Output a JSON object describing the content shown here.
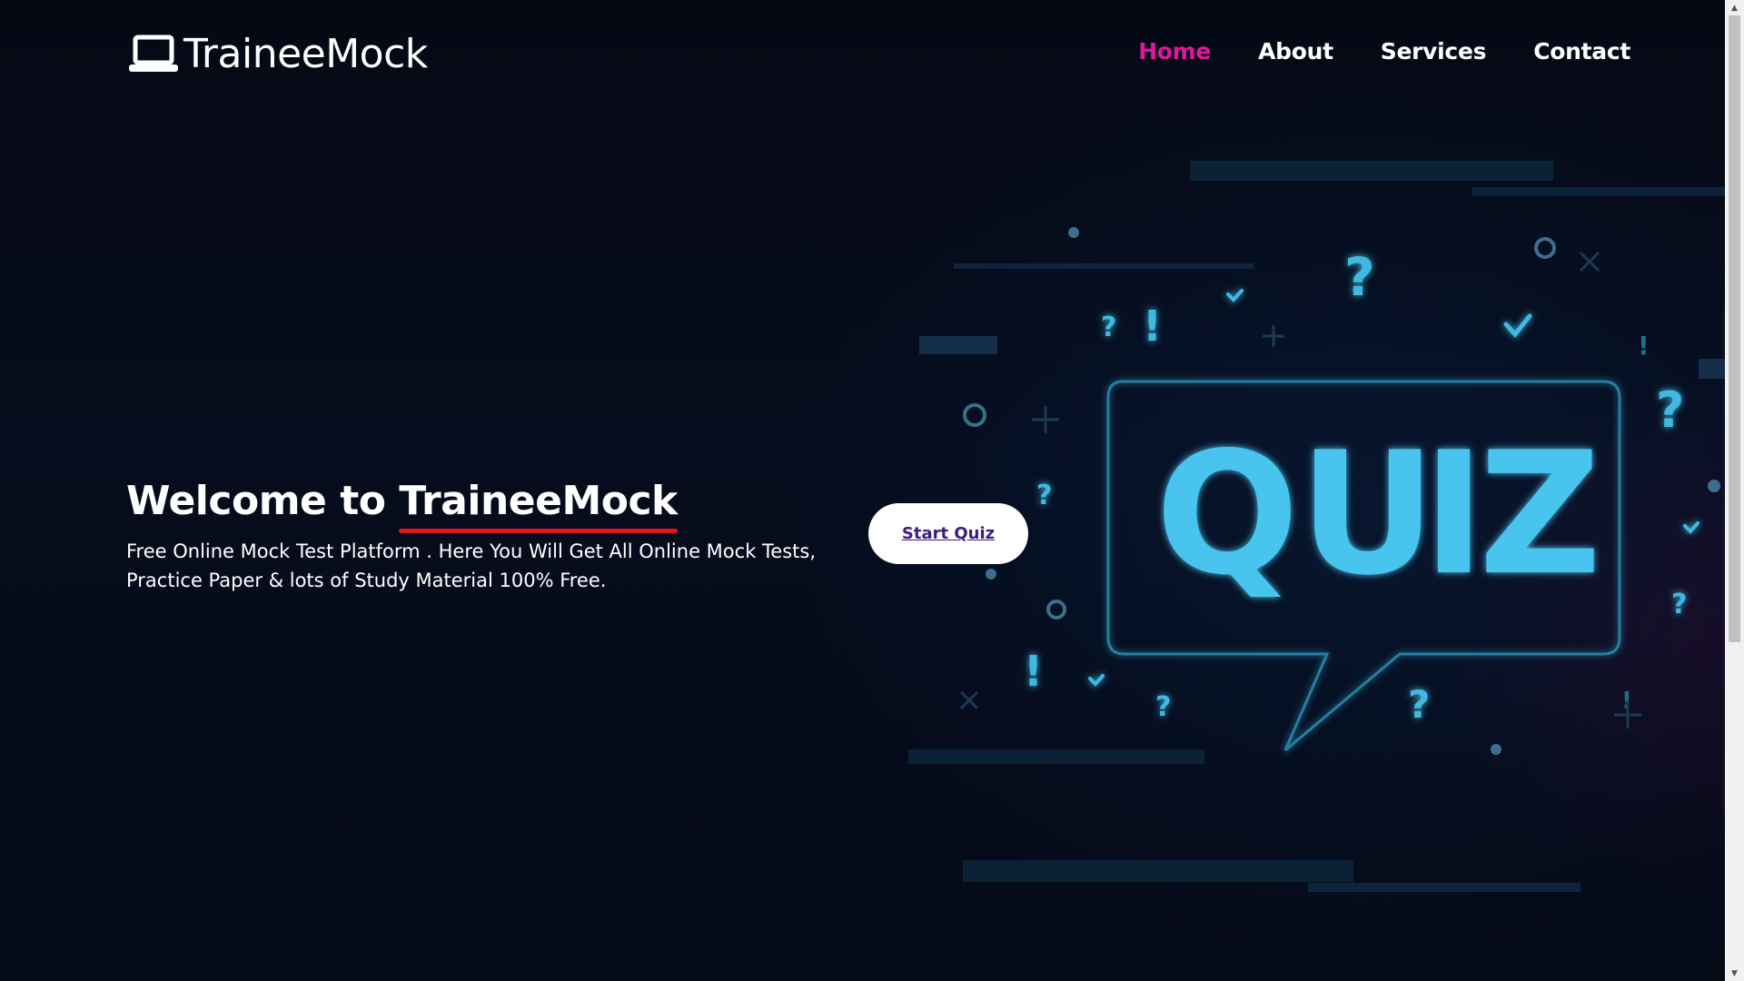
{
  "header": {
    "logo_text": "TraineeMock",
    "logo_icon": "laptop-icon",
    "nav": [
      {
        "label": "Home",
        "active": true
      },
      {
        "label": "About",
        "active": false
      },
      {
        "label": "Services",
        "active": false
      },
      {
        "label": "Contact",
        "active": false
      }
    ]
  },
  "hero": {
    "title_prefix": "Welcome to ",
    "title_brand": "TraineeMock",
    "description": "Free Online Mock Test Platform . Here You Will Get All Online Mock Tests, Practice Paper & lots of Study Material 100% Free.",
    "cta_label": "Start Quiz"
  },
  "illustration": {
    "word": "QUIZ",
    "icon": "quiz-speech-bubble-illustration"
  },
  "colors": {
    "background": "#060c1d",
    "nav_active": "#e0169e",
    "underline": "#e2141b",
    "quiz_cyan": "#4fc9f2",
    "cta_text": "#3d1c80"
  }
}
